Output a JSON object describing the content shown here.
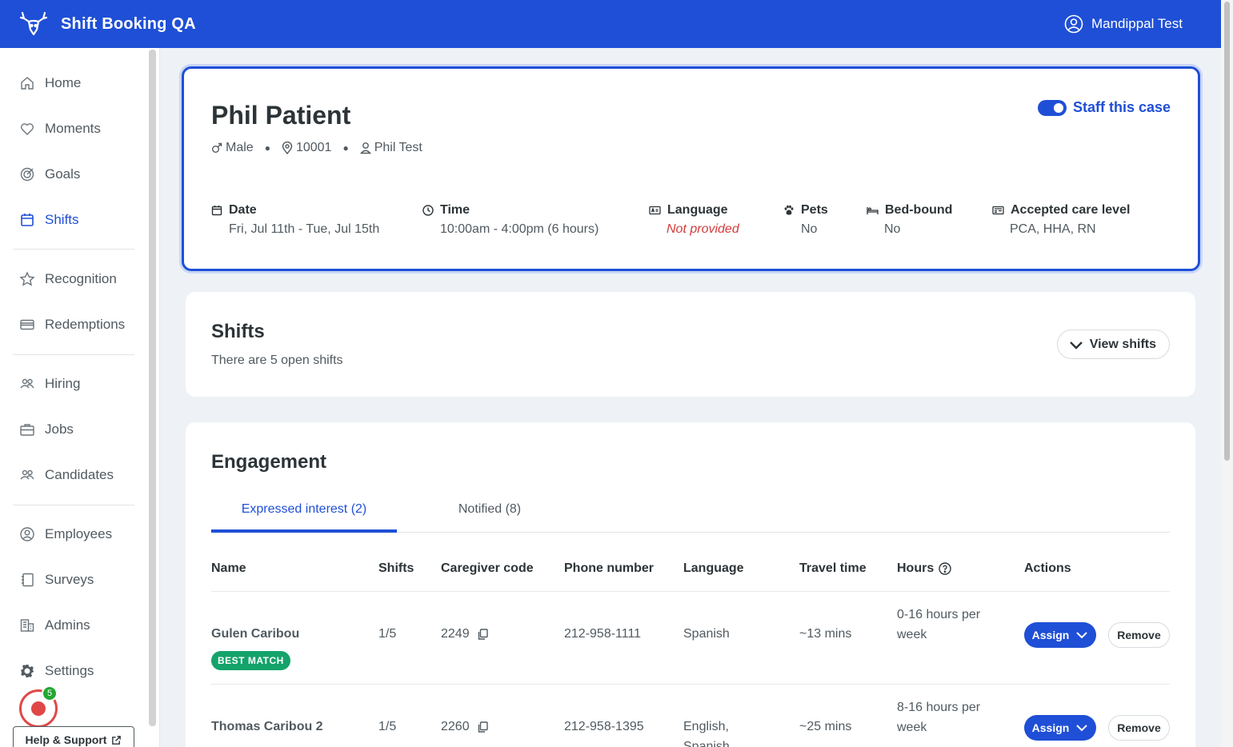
{
  "header": {
    "title": "Shift Booking QA",
    "user": "Mandippal Test"
  },
  "sidebar": {
    "items": [
      {
        "label": "Home",
        "icon": "home-icon"
      },
      {
        "label": "Moments",
        "icon": "heart-icon"
      },
      {
        "label": "Goals",
        "icon": "target-icon"
      },
      {
        "label": "Shifts",
        "icon": "calendar-icon",
        "active": true
      },
      {
        "label": "Recognition",
        "icon": "star-badge-icon"
      },
      {
        "label": "Redemptions",
        "icon": "card-icon"
      },
      {
        "label": "Hiring",
        "icon": "people-icon"
      },
      {
        "label": "Jobs",
        "icon": "briefcase-icon"
      },
      {
        "label": "Candidates",
        "icon": "people-icon"
      },
      {
        "label": "Employees",
        "icon": "user-circle-icon"
      },
      {
        "label": "Surveys",
        "icon": "notebook-icon"
      },
      {
        "label": "Admins",
        "icon": "building-icon"
      },
      {
        "label": "Settings",
        "icon": "gear-icon"
      }
    ],
    "record_badge": "5",
    "help_label": "Help & Support"
  },
  "case": {
    "patient_name": "Phil Patient",
    "gender": "Male",
    "zip": "10001",
    "coordinator": "Phil Test",
    "staff_label": "Staff this case",
    "date_label": "Date",
    "date_value": "Fri, Jul 11th - Tue, Jul 15th",
    "time_label": "Time",
    "time_value": "10:00am - 4:00pm (6 hours)",
    "language_label": "Language",
    "language_value": "Not provided",
    "pets_label": "Pets",
    "pets_value": "No",
    "bedbound_label": "Bed-bound",
    "bedbound_value": "No",
    "care_label": "Accepted care level",
    "care_value": "PCA, HHA, RN"
  },
  "shifts": {
    "title": "Shifts",
    "subtitle": "There are 5 open shifts",
    "view_label": "View shifts"
  },
  "engagement": {
    "title": "Engagement",
    "tabs": [
      "Expressed interest (2)",
      "Notified (8)"
    ],
    "columns": [
      "Name",
      "Shifts",
      "Caregiver code",
      "Phone number",
      "Language",
      "Travel time",
      "Hours",
      "Actions"
    ],
    "rows": [
      {
        "name": "Gulen Caribou",
        "badge": "BEST MATCH",
        "shifts": "1/5",
        "code": "2249",
        "phone": "212-958-1111",
        "language": "Spanish",
        "travel": "~13 mins",
        "hours": "0-16 hours per week"
      },
      {
        "name": "Thomas Caribou 2",
        "badge": "",
        "shifts": "1/5",
        "code": "2260",
        "phone": "212-958-1395",
        "language": "English, Spanish",
        "travel": "~25 mins",
        "hours": "8-16 hours per week"
      }
    ],
    "assign_label": "Assign",
    "remove_label": "Remove"
  },
  "colors": {
    "brand": "#1f4fd6",
    "success": "#14a36a",
    "warning": "#d33b3b"
  }
}
